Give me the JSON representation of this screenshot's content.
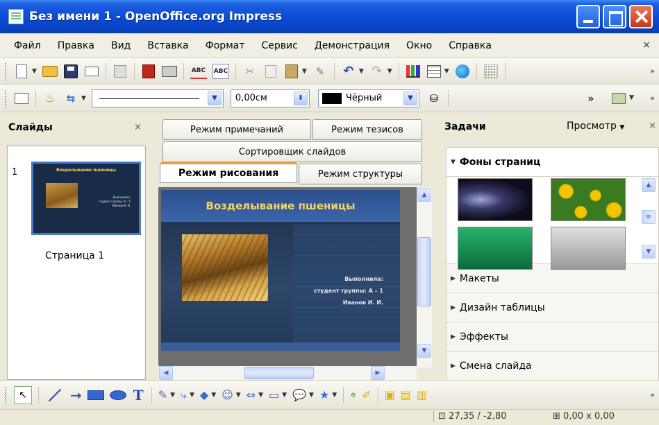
{
  "window": {
    "title": "Без имени 1 - OpenOffice.org Impress",
    "controls": [
      "minimize",
      "maximize",
      "close"
    ]
  },
  "menu": {
    "items": [
      "Файл",
      "Правка",
      "Вид",
      "Вставка",
      "Формат",
      "Сервис",
      "Демонстрация",
      "Окно",
      "Справка"
    ],
    "close": "×"
  },
  "toolbar_standard": {
    "icons": [
      "new-document-icon",
      "open-folder-icon",
      "save-icon",
      "email-icon",
      "edit-file-icon",
      "export-pdf-icon",
      "print-icon",
      "spellcheck-icon",
      "autospellcheck-icon",
      "cut-icon",
      "copy-icon",
      "paste-icon",
      "clone-formatting-icon",
      "undo-icon",
      "redo-icon",
      "chart-icon",
      "table-icon",
      "navigator-icon",
      "grid-icon"
    ],
    "spell_label": "ABC",
    "more": "»"
  },
  "toolbar_line": {
    "line_width": "0,00см",
    "color_name": "Чёрный",
    "color_hex": "#000000",
    "more": "»"
  },
  "slides_panel": {
    "title": "Слайды",
    "close": "×",
    "slides": [
      {
        "number": "1",
        "caption": "Страница 1"
      }
    ]
  },
  "view_tabs": {
    "row1": [
      "Режим примечаний",
      "Режим тезисов"
    ],
    "row2": [
      "Сортировщик слайдов"
    ],
    "row3": [
      "Режим рисования",
      "Режим структуры"
    ],
    "active": "Режим рисования"
  },
  "slide": {
    "title": "Возделывание пшеницы",
    "text_lines": [
      "Выполнила:",
      "студент группы: А – 1",
      "Иванов И. И."
    ]
  },
  "tasks_panel": {
    "title": "Задачи",
    "view_menu": "Просмотр",
    "close": "×",
    "open_section": "Фоны страниц",
    "sections": [
      "Макеты",
      "Дизайн таблицы",
      "Эффекты",
      "Смена слайда"
    ]
  },
  "status": {
    "position": "27,35 / -2,80",
    "size": "0,00 x 0,00"
  },
  "colors": {
    "titlebar": "#0a4ed6",
    "slide_bg": "#1c2f4c",
    "slide_title": "#f3d46a",
    "accent_tab": "#f0a030"
  }
}
